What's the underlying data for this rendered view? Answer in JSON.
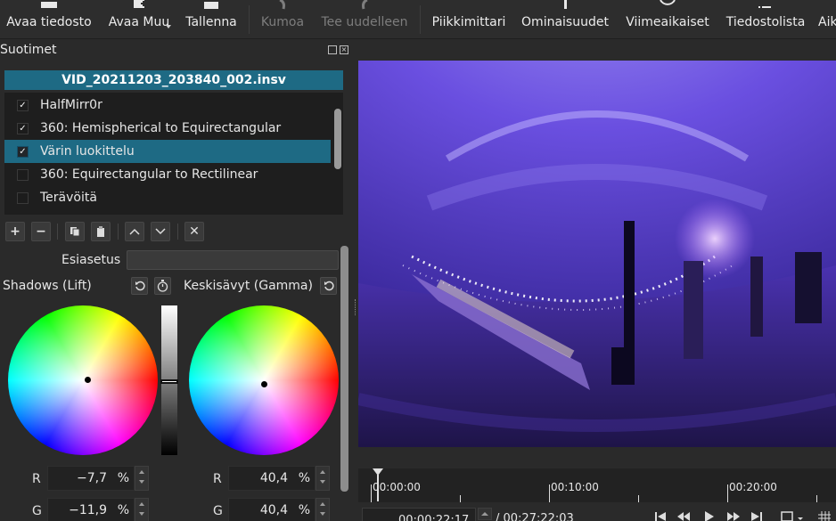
{
  "toolbar": {
    "open_file": "Avaa tiedosto",
    "open_other": "Avaa Muu",
    "save": "Tallenna",
    "undo": "Kumoa",
    "redo": "Tee uudelleen",
    "peak_meter": "Piikkimittari",
    "properties": "Ominaisuudet",
    "recent": "Viimeaikaiset",
    "playlist": "Tiedostolista",
    "history_partial": "Aik"
  },
  "filters_panel": {
    "title": "Suotimet",
    "clip_name": "VID_20211203_203840_002.insv",
    "filters": [
      {
        "name": "HalfMirr0r",
        "checked": true,
        "selected": false
      },
      {
        "name": "360: Hemispherical to Equirectangular",
        "checked": true,
        "selected": false
      },
      {
        "name": "Värin luokittelu",
        "checked": true,
        "selected": true
      },
      {
        "name": "360: Equirectangular to Rectilinear",
        "checked": false,
        "selected": false
      },
      {
        "name": "Terävöitä",
        "checked": false,
        "selected": false
      }
    ],
    "check_mark": "✓",
    "preset_label": "Esiasetus",
    "preset_value": ""
  },
  "color_grading": {
    "shadows_label": "Shadows (Lift)",
    "midtones_label": "Keskisävyt (Gamma)",
    "shadows": {
      "r_label": "R",
      "r_value": "−7,7",
      "g_label": "G",
      "g_value": "−11,9",
      "unit": "%"
    },
    "midtones": {
      "r_label": "R",
      "r_value": "40,4",
      "g_label": "G",
      "g_value": "40,4",
      "unit": "%"
    }
  },
  "timeline": {
    "ticks": [
      "00:00:00",
      "00:10:00",
      "00:20:00"
    ],
    "current_time": "00:00:22:17",
    "total_time": "/ 00:27:22:03"
  },
  "colors": {
    "accent": "#1e6a84",
    "panel_bg": "#2a2a2a",
    "video_tint": "#5b3ed8"
  }
}
